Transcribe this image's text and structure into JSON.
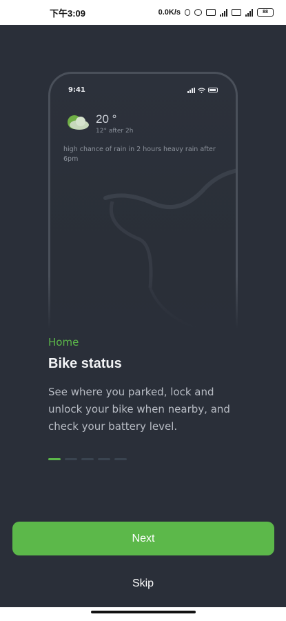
{
  "status_bar": {
    "time": "下午3:09",
    "net_speed": "0.0K/s",
    "battery": "88"
  },
  "phone_mockup": {
    "time": "9:41",
    "weather": {
      "temperature": "20 °",
      "sub": "12° after 2h",
      "description": "high chance of rain in 2 hours heavy rain after 6pm"
    }
  },
  "content": {
    "eyebrow": "Home",
    "title": "Bike status",
    "description": "See where you parked, lock and unlock your bike when nearby, and check your battery level."
  },
  "pagination": {
    "total": 5,
    "active_index": 0
  },
  "actions": {
    "next_label": "Next",
    "skip_label": "Skip"
  },
  "colors": {
    "accent": "#5cb84a",
    "background": "#2a2f39"
  }
}
